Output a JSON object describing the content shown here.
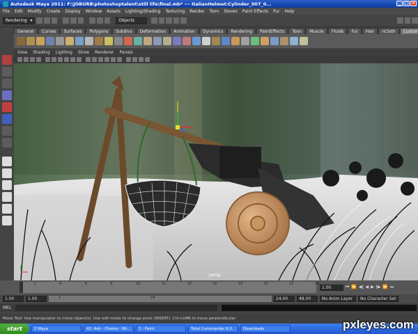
{
  "window": {
    "title": "Autodesk Maya 2011: F:\\JOBURB\\photoshoptalent\\still life\\final.mb*  ---  ItalianHelmet:Cylinder_007_0..."
  },
  "menu": {
    "items": [
      "File",
      "Edit",
      "Modify",
      "Create",
      "Display",
      "Window",
      "Assets",
      "Lighting/Shading",
      "Texturing",
      "Render",
      "Toon",
      "Stereo",
      "Paint Effects",
      "Fur",
      "Help"
    ]
  },
  "status_line": {
    "mode_dropdown": "Rendering",
    "objects_field": "Objects"
  },
  "shelf": {
    "tabs": [
      "General",
      "Curves",
      "Surfaces",
      "Polygons",
      "Subdivs",
      "Deformation",
      "Animation",
      "Dynamics",
      "Rendering",
      "PaintEffects",
      "Toon",
      "Muscle",
      "Fluids",
      "Fur",
      "Hair",
      "nCloth",
      "Custom"
    ],
    "active_tab": "Custom"
  },
  "panel": {
    "menu": [
      "View",
      "Shading",
      "Lighting",
      "Show",
      "Renderer",
      "Panels"
    ],
    "camera_label": "persp"
  },
  "time_slider": {
    "ticks": [
      "1",
      "2",
      "4",
      "6",
      "8",
      "10",
      "12",
      "14",
      "16",
      "18",
      "20",
      "22",
      "24"
    ],
    "current_frame": "1.00"
  },
  "range_slider": {
    "start_time": "1.00",
    "playback_start": "1.00",
    "range_start_value": "1",
    "range_end_value": "24",
    "playback_end": "24.00",
    "end_time": "48.00",
    "anim_layer": "No Anim Layer",
    "character_set": "No Character Set"
  },
  "command_line": {
    "label": "MEL"
  },
  "help_line": {
    "text": "Move Tool: Use manipulator to move object(s). Use edit mode to change pivot (INSERT). Ctrl+LMB to move perpendicular."
  },
  "taskbar": {
    "start_label": "start",
    "tasks": [
      "2 Maya",
      "43. Ash - Chemo - Wi...",
      "3 - Paint",
      "Total Commander 6.0...",
      "Downloads"
    ]
  },
  "watermark": "pxleyes.com",
  "colors": {
    "title_blue": "#0a3aa3",
    "taskbar_blue": "#2357d0",
    "start_green": "#3d9b2a",
    "maya_gray": "#444444"
  }
}
